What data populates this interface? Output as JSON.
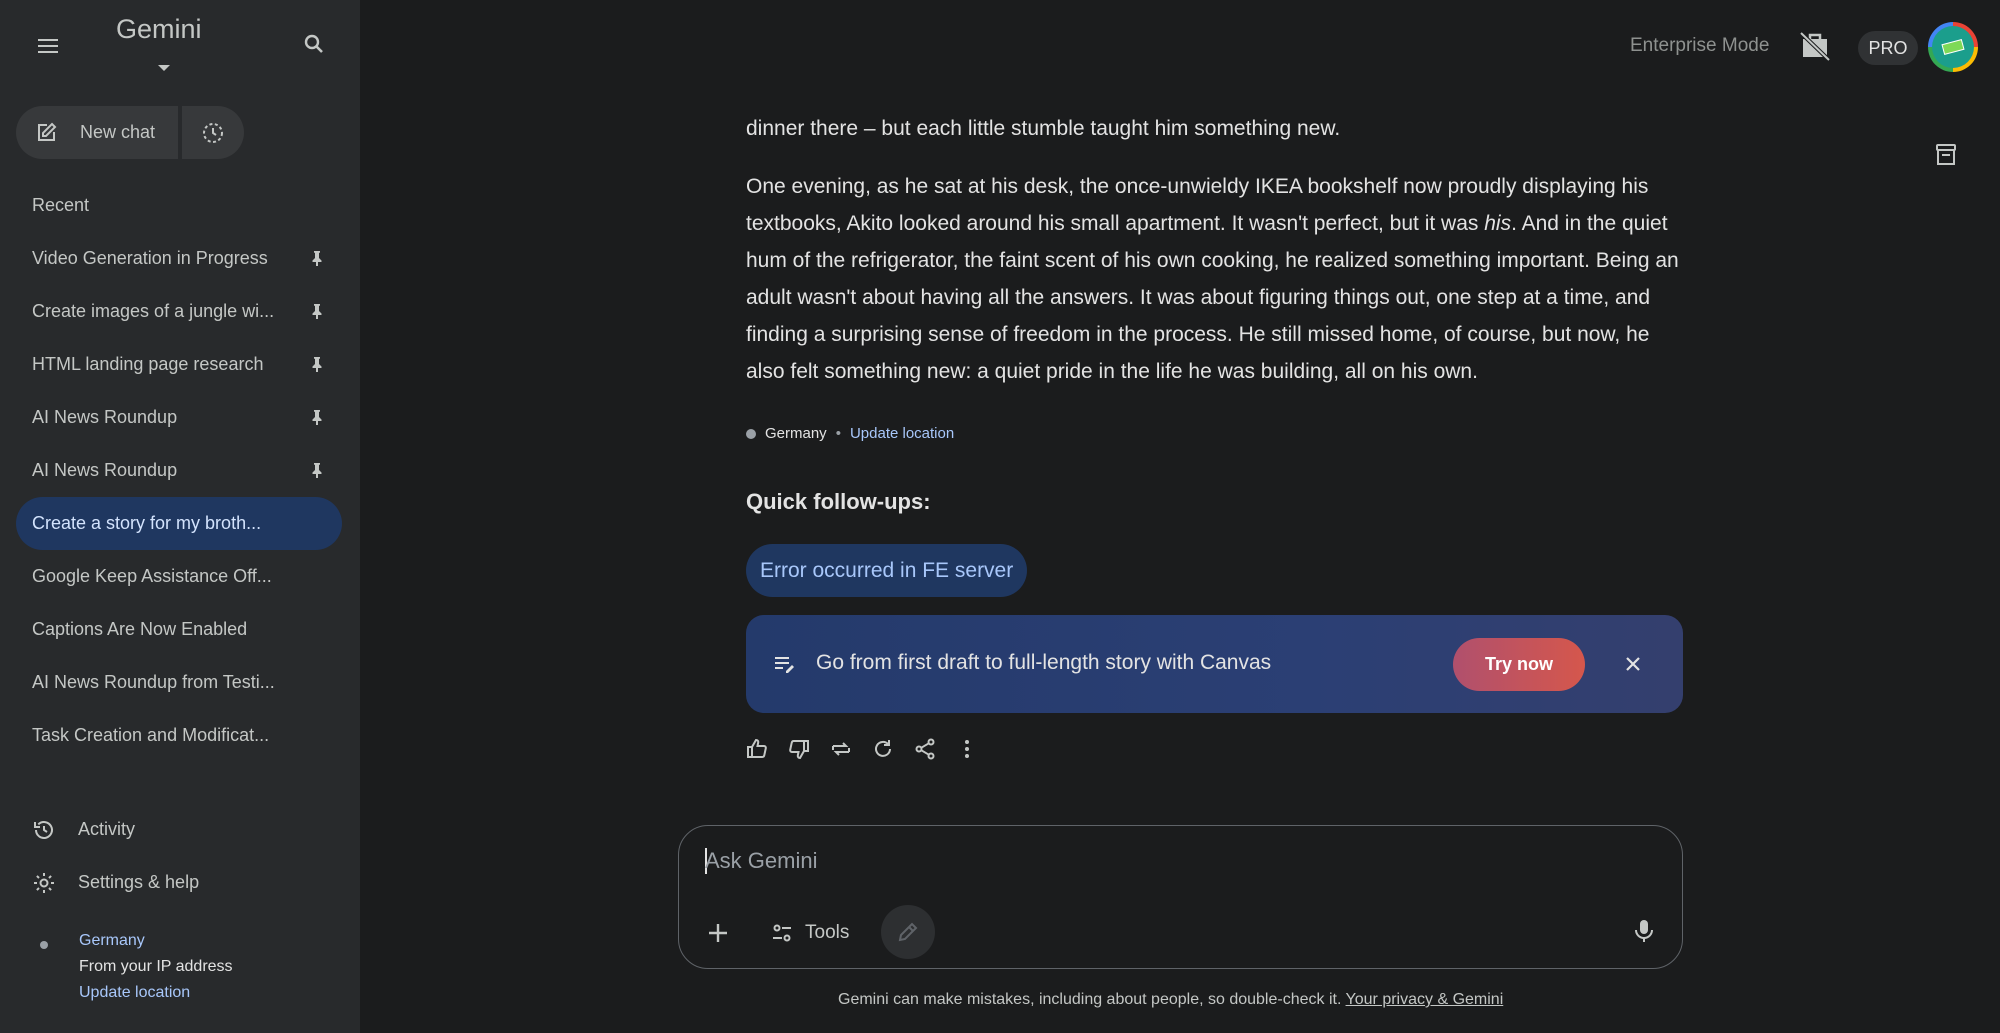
{
  "sidebar": {
    "brand": "Gemini",
    "new_chat_label": "New chat",
    "recent_label": "Recent",
    "recent": [
      {
        "title": "Video Generation in Progress",
        "pinned": true
      },
      {
        "title": "Create images of a jungle wi...",
        "pinned": true
      },
      {
        "title": "HTML landing page research",
        "pinned": true
      },
      {
        "title": "AI News Roundup",
        "pinned": true
      },
      {
        "title": "AI News Roundup",
        "pinned": true
      },
      {
        "title": "Create a story for my broth...",
        "pinned": false,
        "active": true
      },
      {
        "title": "Google Keep Assistance Off...",
        "pinned": false
      },
      {
        "title": "Captions Are Now Enabled",
        "pinned": false
      },
      {
        "title": "AI News Roundup from Testi...",
        "pinned": false
      },
      {
        "title": "Task Creation and Modificat...",
        "pinned": false
      }
    ],
    "activity_label": "Activity",
    "settings_label": "Settings & help",
    "location": {
      "country": "Germany",
      "source": "From your IP address",
      "update": "Update location"
    }
  },
  "topbar": {
    "enterprise_mode": "Enterprise Mode",
    "plan_badge": "PRO"
  },
  "response": {
    "partial_line": "dinner there – but each little stumble taught him something new.",
    "paragraph_before_em": "One evening, as he sat at his desk, the once-unwieldy IKEA bookshelf now proudly displaying his textbooks, Akito looked around his small apartment. It wasn't perfect, but it was ",
    "paragraph_em": "his",
    "paragraph_after_em": ". And in the quiet hum of the refrigerator, the faint scent of his own cooking, he realized something important. Being an adult wasn't about having all the answers. It was about figuring things out, one step at a time, and finding a surprising sense of freedom in the process. He still missed home, of course, but now, he also felt something new: a quiet pride in the life he was building, all on his own.",
    "source_country": "Germany",
    "source_separator": "•",
    "source_update": "Update location"
  },
  "followups": {
    "title": "Quick follow-ups:",
    "chips": [
      "Error occurred in FE server"
    ]
  },
  "promo": {
    "text": "Go from first draft to full-length story with Canvas",
    "cta": "Try now"
  },
  "composer": {
    "placeholder": "Ask Gemini",
    "value": "",
    "tools_label": "Tools"
  },
  "footer": {
    "disclaimer": "Gemini can make mistakes, including about people, so double-check it.",
    "privacy_link": "Your privacy & Gemini"
  },
  "icons": {
    "menu": "menu-icon",
    "search": "search-icon",
    "new_chat": "edit-icon",
    "temporary_chat": "temporary-chat-icon",
    "pin": "pin-icon",
    "activity": "history-icon",
    "settings": "gear-icon",
    "briefcase": "briefcase-off-icon",
    "archive": "archive-icon",
    "thumbs_up": "thumbs-up-icon",
    "thumbs_down": "thumbs-down-icon",
    "modify": "modify-response-icon",
    "regenerate": "regenerate-icon",
    "share": "share-icon",
    "more": "more-vert-icon",
    "promo": "canvas-icon",
    "close": "close-icon",
    "plus": "plus-icon",
    "tools": "tools-icon",
    "canvas": "pencil-icon",
    "mic": "mic-icon"
  },
  "colors": {
    "background": "#1b1c1d",
    "sidebar": "#282a2c",
    "active_item": "#1f3760",
    "link": "#a8c7fa",
    "cta_start": "#b0506d",
    "cta_end": "#d5574c"
  }
}
